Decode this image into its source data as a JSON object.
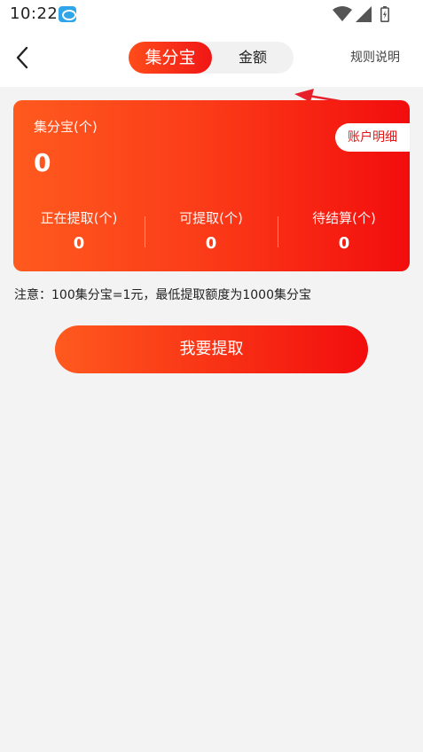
{
  "status_bar": {
    "time": "10:22",
    "icons": [
      "app-notification-icon",
      "wifi-icon",
      "signal-icon",
      "battery-icon"
    ]
  },
  "header": {
    "tabs": [
      {
        "label": "集分宝",
        "active": true
      },
      {
        "label": "金额",
        "active": false
      }
    ],
    "rules_link": "规则说明"
  },
  "card": {
    "label": "集分宝(个)",
    "value": "0",
    "account_button": "账户明细",
    "stats": [
      {
        "label": "正在提取(个)",
        "value": "0"
      },
      {
        "label": "可提取(个)",
        "value": "0"
      },
      {
        "label": "待结算(个)",
        "value": "0"
      }
    ]
  },
  "notice": "注意：100集分宝=1元，最低提取额度为1000集分宝",
  "withdraw_button": "我要提取",
  "colors": {
    "accent_start": "#ff5a1e",
    "accent_end": "#f20d0d",
    "annotation_arrow": "#e8202a",
    "background": "#f3f3f3"
  }
}
